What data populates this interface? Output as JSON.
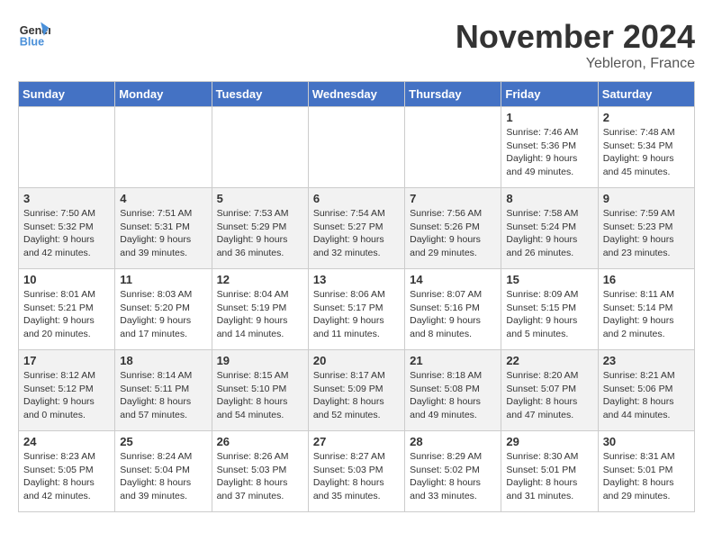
{
  "header": {
    "logo_line1": "General",
    "logo_line2": "Blue",
    "month": "November 2024",
    "location": "Yebleron, France"
  },
  "weekdays": [
    "Sunday",
    "Monday",
    "Tuesday",
    "Wednesday",
    "Thursday",
    "Friday",
    "Saturday"
  ],
  "weeks": [
    [
      {
        "day": "",
        "info": ""
      },
      {
        "day": "",
        "info": ""
      },
      {
        "day": "",
        "info": ""
      },
      {
        "day": "",
        "info": ""
      },
      {
        "day": "",
        "info": ""
      },
      {
        "day": "1",
        "info": "Sunrise: 7:46 AM\nSunset: 5:36 PM\nDaylight: 9 hours\nand 49 minutes."
      },
      {
        "day": "2",
        "info": "Sunrise: 7:48 AM\nSunset: 5:34 PM\nDaylight: 9 hours\nand 45 minutes."
      }
    ],
    [
      {
        "day": "3",
        "info": "Sunrise: 7:50 AM\nSunset: 5:32 PM\nDaylight: 9 hours\nand 42 minutes."
      },
      {
        "day": "4",
        "info": "Sunrise: 7:51 AM\nSunset: 5:31 PM\nDaylight: 9 hours\nand 39 minutes."
      },
      {
        "day": "5",
        "info": "Sunrise: 7:53 AM\nSunset: 5:29 PM\nDaylight: 9 hours\nand 36 minutes."
      },
      {
        "day": "6",
        "info": "Sunrise: 7:54 AM\nSunset: 5:27 PM\nDaylight: 9 hours\nand 32 minutes."
      },
      {
        "day": "7",
        "info": "Sunrise: 7:56 AM\nSunset: 5:26 PM\nDaylight: 9 hours\nand 29 minutes."
      },
      {
        "day": "8",
        "info": "Sunrise: 7:58 AM\nSunset: 5:24 PM\nDaylight: 9 hours\nand 26 minutes."
      },
      {
        "day": "9",
        "info": "Sunrise: 7:59 AM\nSunset: 5:23 PM\nDaylight: 9 hours\nand 23 minutes."
      }
    ],
    [
      {
        "day": "10",
        "info": "Sunrise: 8:01 AM\nSunset: 5:21 PM\nDaylight: 9 hours\nand 20 minutes."
      },
      {
        "day": "11",
        "info": "Sunrise: 8:03 AM\nSunset: 5:20 PM\nDaylight: 9 hours\nand 17 minutes."
      },
      {
        "day": "12",
        "info": "Sunrise: 8:04 AM\nSunset: 5:19 PM\nDaylight: 9 hours\nand 14 minutes."
      },
      {
        "day": "13",
        "info": "Sunrise: 8:06 AM\nSunset: 5:17 PM\nDaylight: 9 hours\nand 11 minutes."
      },
      {
        "day": "14",
        "info": "Sunrise: 8:07 AM\nSunset: 5:16 PM\nDaylight: 9 hours\nand 8 minutes."
      },
      {
        "day": "15",
        "info": "Sunrise: 8:09 AM\nSunset: 5:15 PM\nDaylight: 9 hours\nand 5 minutes."
      },
      {
        "day": "16",
        "info": "Sunrise: 8:11 AM\nSunset: 5:14 PM\nDaylight: 9 hours\nand 2 minutes."
      }
    ],
    [
      {
        "day": "17",
        "info": "Sunrise: 8:12 AM\nSunset: 5:12 PM\nDaylight: 9 hours\nand 0 minutes."
      },
      {
        "day": "18",
        "info": "Sunrise: 8:14 AM\nSunset: 5:11 PM\nDaylight: 8 hours\nand 57 minutes."
      },
      {
        "day": "19",
        "info": "Sunrise: 8:15 AM\nSunset: 5:10 PM\nDaylight: 8 hours\nand 54 minutes."
      },
      {
        "day": "20",
        "info": "Sunrise: 8:17 AM\nSunset: 5:09 PM\nDaylight: 8 hours\nand 52 minutes."
      },
      {
        "day": "21",
        "info": "Sunrise: 8:18 AM\nSunset: 5:08 PM\nDaylight: 8 hours\nand 49 minutes."
      },
      {
        "day": "22",
        "info": "Sunrise: 8:20 AM\nSunset: 5:07 PM\nDaylight: 8 hours\nand 47 minutes."
      },
      {
        "day": "23",
        "info": "Sunrise: 8:21 AM\nSunset: 5:06 PM\nDaylight: 8 hours\nand 44 minutes."
      }
    ],
    [
      {
        "day": "24",
        "info": "Sunrise: 8:23 AM\nSunset: 5:05 PM\nDaylight: 8 hours\nand 42 minutes."
      },
      {
        "day": "25",
        "info": "Sunrise: 8:24 AM\nSunset: 5:04 PM\nDaylight: 8 hours\nand 39 minutes."
      },
      {
        "day": "26",
        "info": "Sunrise: 8:26 AM\nSunset: 5:03 PM\nDaylight: 8 hours\nand 37 minutes."
      },
      {
        "day": "27",
        "info": "Sunrise: 8:27 AM\nSunset: 5:03 PM\nDaylight: 8 hours\nand 35 minutes."
      },
      {
        "day": "28",
        "info": "Sunrise: 8:29 AM\nSunset: 5:02 PM\nDaylight: 8 hours\nand 33 minutes."
      },
      {
        "day": "29",
        "info": "Sunrise: 8:30 AM\nSunset: 5:01 PM\nDaylight: 8 hours\nand 31 minutes."
      },
      {
        "day": "30",
        "info": "Sunrise: 8:31 AM\nSunset: 5:01 PM\nDaylight: 8 hours\nand 29 minutes."
      }
    ]
  ]
}
